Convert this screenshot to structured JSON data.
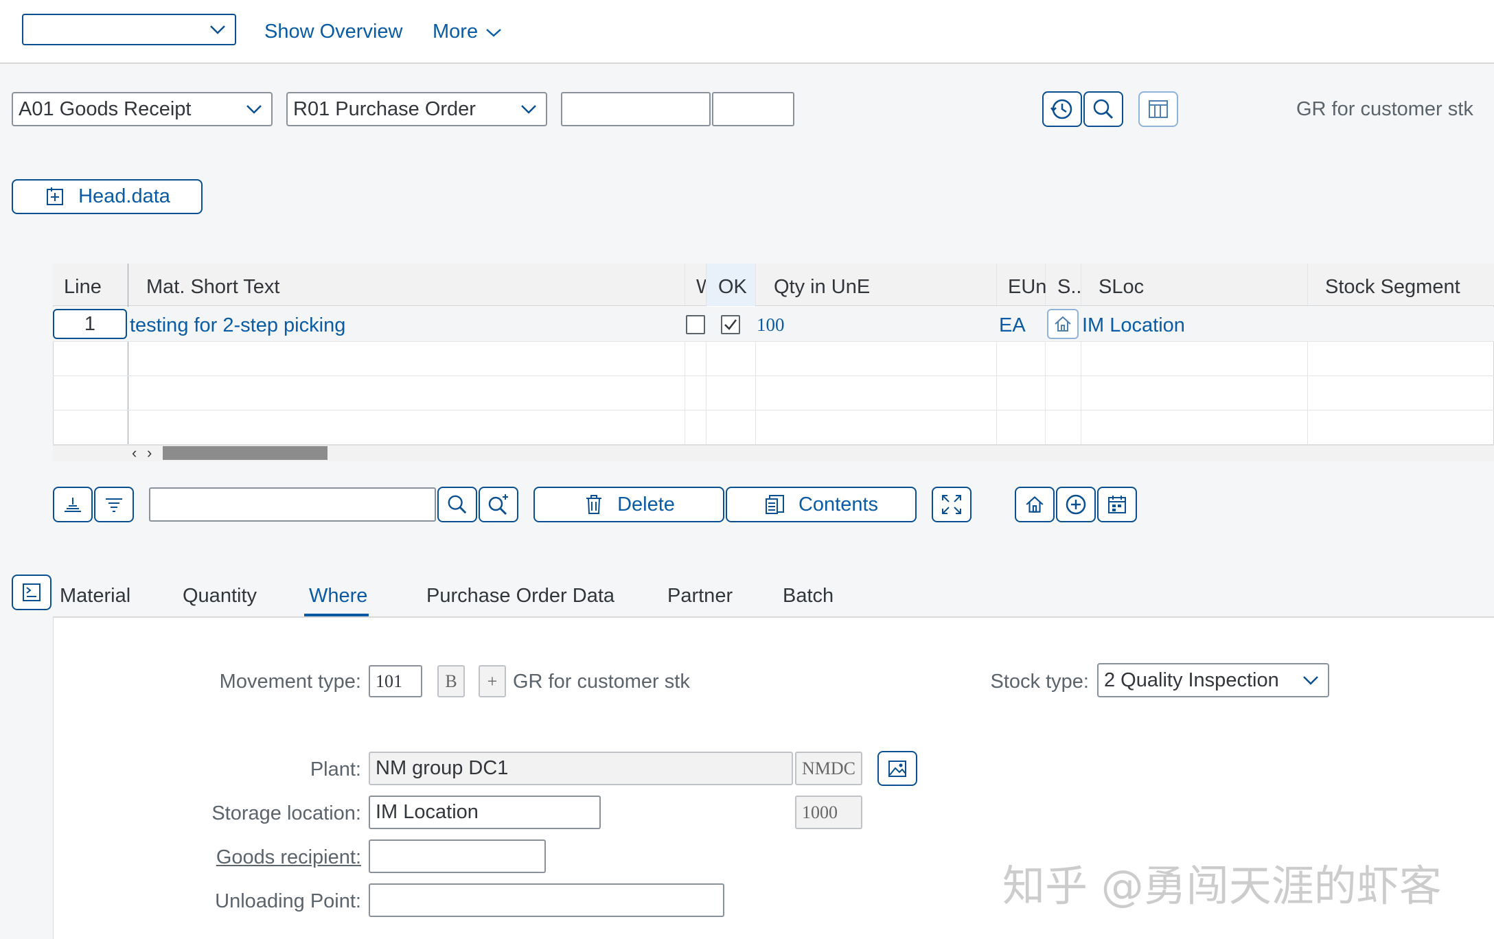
{
  "toolbar": {
    "selector_value": "",
    "show_overview": "Show Overview",
    "more": "More"
  },
  "header": {
    "transaction": "A01 Goods Receipt",
    "reference_doc": "R01 Purchase Order",
    "doc_number": "",
    "doc_item": "",
    "mvt_text": "GR for customer stk",
    "head_data_button": "Head.data"
  },
  "table": {
    "columns": [
      "Line",
      "Mat. Short Text",
      "W",
      "OK",
      "Qty in UnE",
      "EUn",
      "S...",
      "SLoc",
      "Stock Segment"
    ],
    "rows": [
      {
        "line": "1",
        "text": "testing for 2-step picking",
        "w": false,
        "ok": true,
        "qty": "100",
        "eun": "EA",
        "sloc": "IM Location",
        "segment": ""
      }
    ]
  },
  "table_toolbar": {
    "search_value": "",
    "delete": "Delete",
    "contents": "Contents"
  },
  "tabs": [
    {
      "label": "Material",
      "active": false
    },
    {
      "label": "Quantity",
      "active": false
    },
    {
      "label": "Where",
      "active": true
    },
    {
      "label": "Purchase Order Data",
      "active": false
    },
    {
      "label": "Partner",
      "active": false
    },
    {
      "label": "Batch",
      "active": false
    }
  ],
  "where": {
    "movement_type_label": "Movement type:",
    "movement_type": "101",
    "mvt_indicator": "B",
    "mvt_plus": "+",
    "movement_text": "GR for customer stk",
    "stock_type_label": "Stock type:",
    "stock_type": "2 Quality Inspection",
    "plant_label": "Plant:",
    "plant": "NM group DC1",
    "plant_code": "NMDC",
    "storage_location_label": "Storage location:",
    "storage_location": "IM Location",
    "storage_location_code": "1000",
    "goods_recipient_label": "Goods recipient:",
    "goods_recipient": "",
    "unloading_point_label": "Unloading Point:",
    "unloading_point": ""
  },
  "watermark": "知乎 @勇闯天涯的虾客",
  "colors": {
    "brand_blue": "#0a5ba3",
    "border_blue": "#0a4f8f",
    "background": "#f5f6f7"
  }
}
